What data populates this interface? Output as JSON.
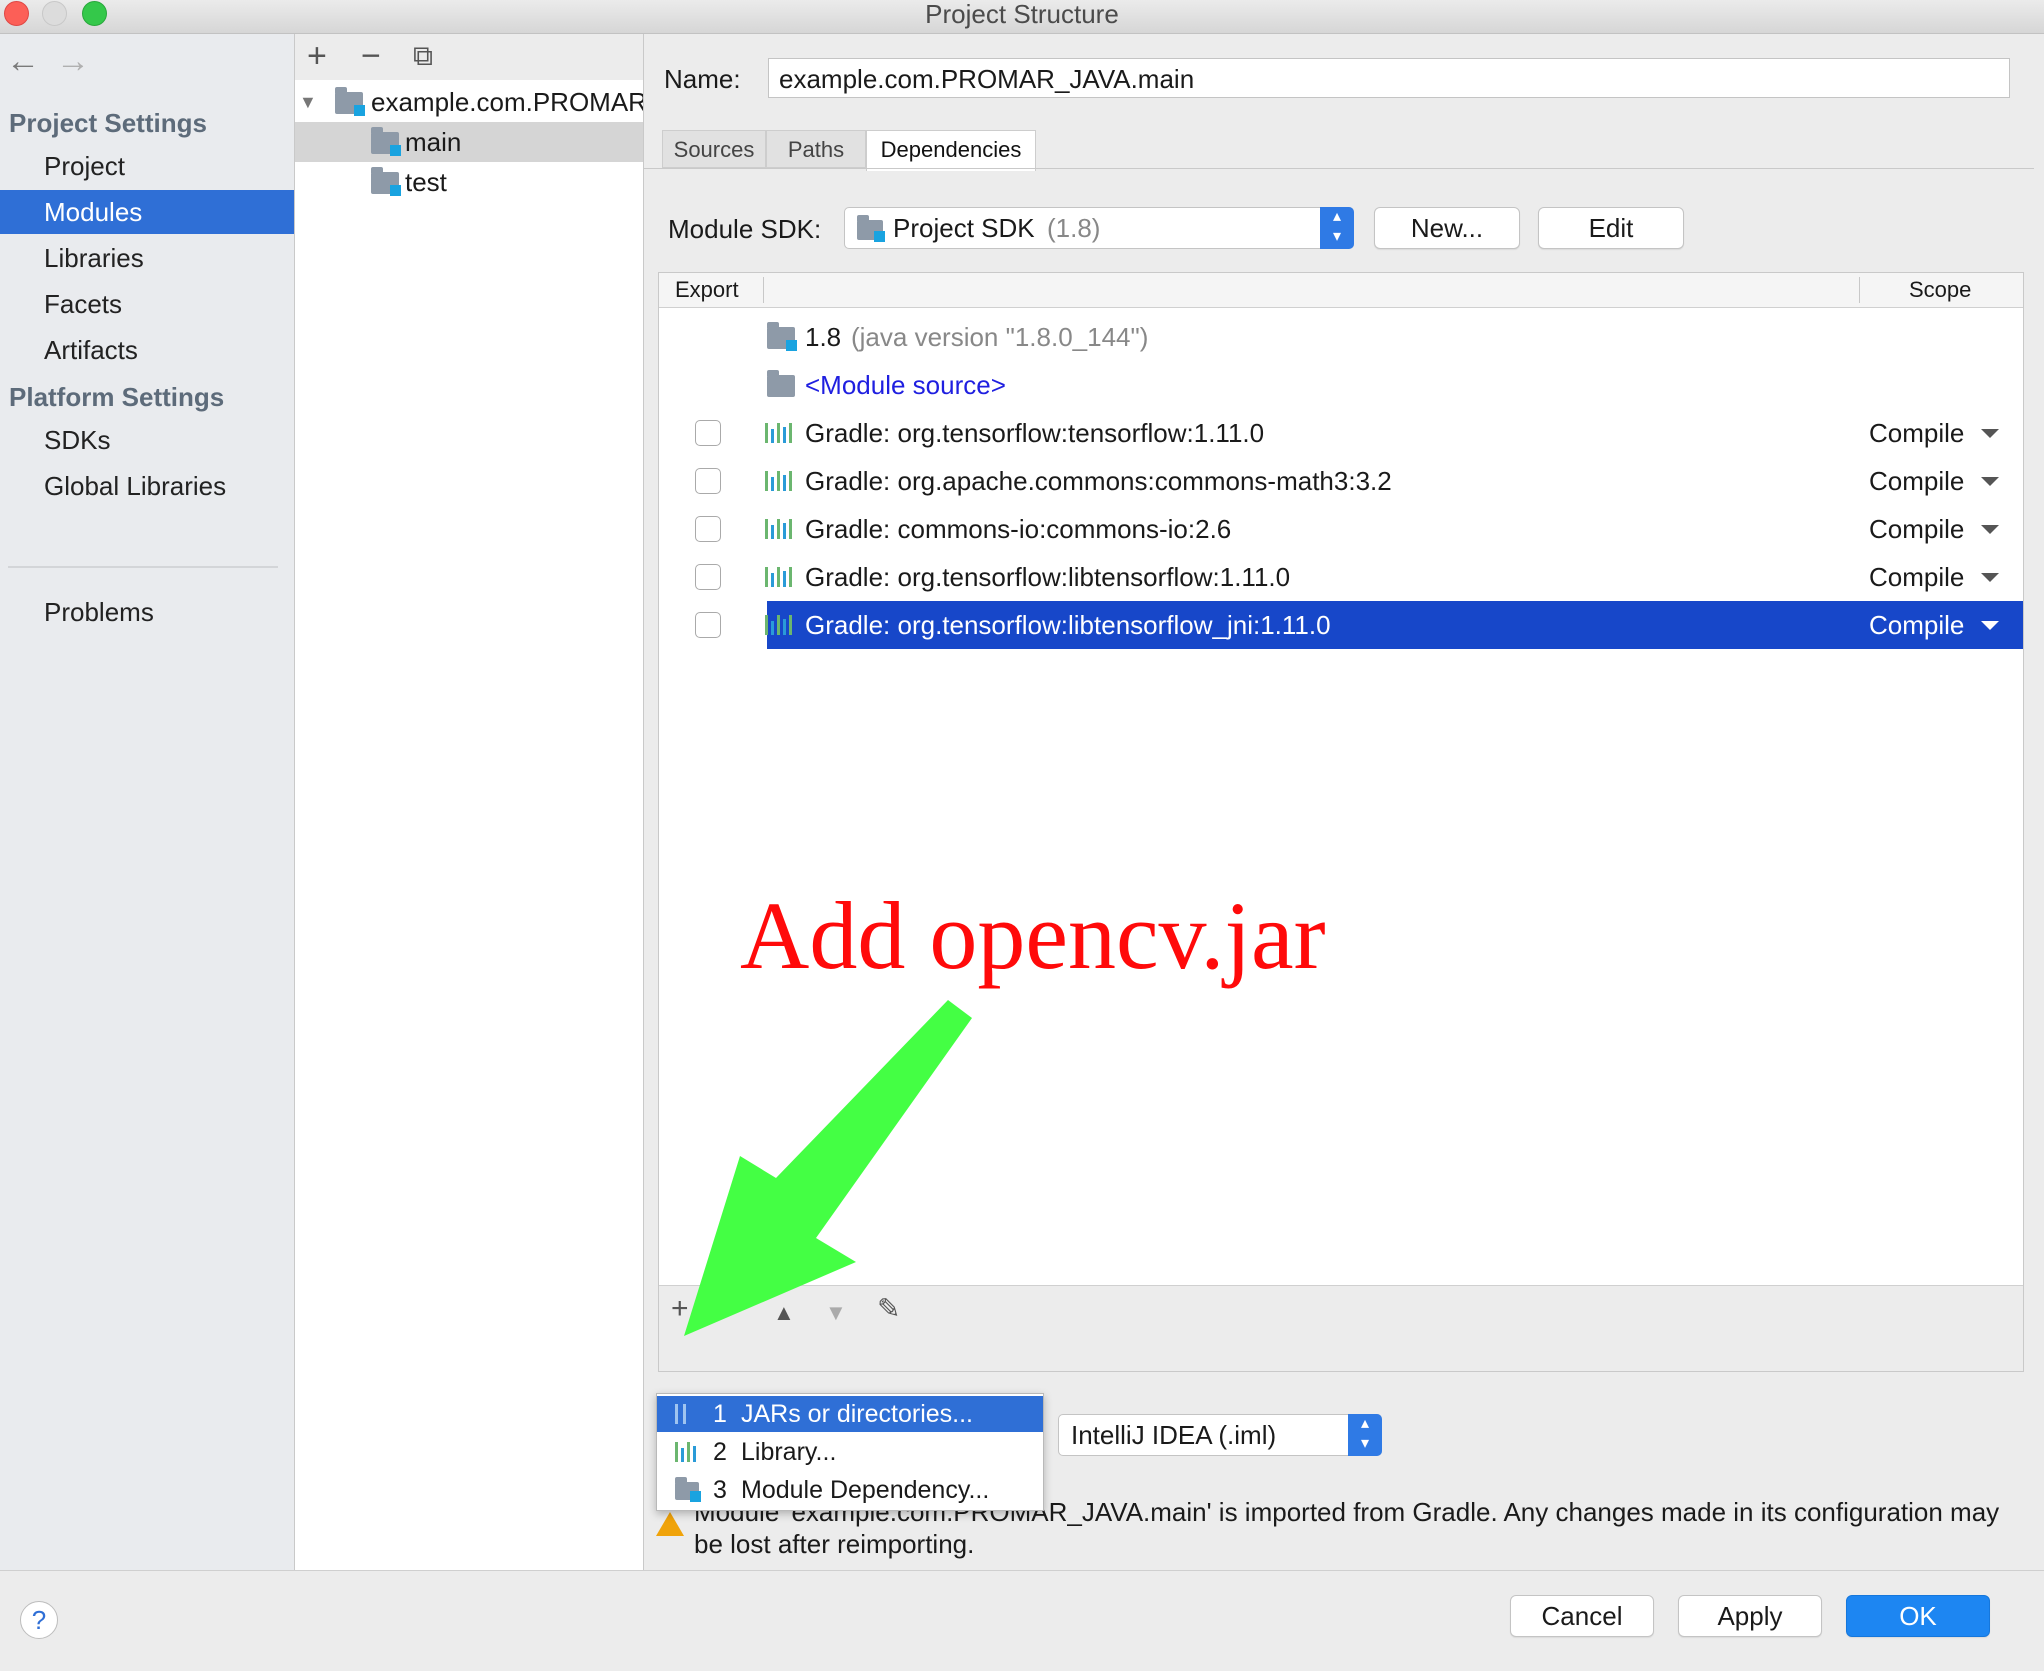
{
  "window": {
    "title": "Project Structure"
  },
  "nav": {
    "back": "←",
    "forward": "→",
    "project_settings_header": "Project Settings",
    "project_settings": [
      "Project",
      "Modules",
      "Libraries",
      "Facets",
      "Artifacts"
    ],
    "platform_settings_header": "Platform Settings",
    "platform_settings": [
      "SDKs",
      "Global Libraries"
    ],
    "problems": "Problems",
    "selected": "Modules"
  },
  "tree": {
    "toolbar": [
      "+",
      "−",
      "⧉"
    ],
    "root": "example.com.PROMAR",
    "children": [
      "main",
      "test"
    ],
    "selected": "main"
  },
  "module": {
    "name_label": "Name:",
    "name_value": "example.com.PROMAR_JAVA.main",
    "tabs": [
      "Sources",
      "Paths",
      "Dependencies"
    ],
    "active_tab": "Dependencies",
    "sdk_label": "Module SDK:",
    "sdk_value": "Project SDK",
    "sdk_version": "(1.8)",
    "new_button": "New...",
    "edit_button": "Edit"
  },
  "dependencies": {
    "col_export": "Export",
    "col_scope": "Scope",
    "jdk_name": "1.8",
    "jdk_detail": "(java version \"1.8.0_144\")",
    "module_source": "<Module source>",
    "rows": [
      {
        "name": "Gradle: org.tensorflow:tensorflow:1.11.0",
        "scope": "Compile"
      },
      {
        "name": "Gradle: org.apache.commons:commons-math3:3.2",
        "scope": "Compile"
      },
      {
        "name": "Gradle: commons-io:commons-io:2.6",
        "scope": "Compile"
      },
      {
        "name": "Gradle: org.tensorflow:libtensorflow:1.11.0",
        "scope": "Compile"
      },
      {
        "name": "Gradle: org.tensorflow:libtensorflow_jni:1.11.0",
        "scope": "Compile"
      }
    ],
    "selected_index": 4,
    "toolbar": [
      "+",
      "−",
      "▲",
      "▼",
      "✎"
    ]
  },
  "popup_menu": {
    "items": [
      {
        "num": "1",
        "label": "JARs or directories..."
      },
      {
        "num": "2",
        "label": "Library..."
      },
      {
        "num": "3",
        "label": "Module Dependency..."
      }
    ],
    "highlighted": 0
  },
  "format_combo": "IntelliJ IDEA (.iml)",
  "warning": "Module 'example.com.PROMAR_JAVA.main' is imported from Gradle. Any changes made in its configuration may be lost after reimporting.",
  "buttons": {
    "help": "?",
    "cancel": "Cancel",
    "apply": "Apply",
    "ok": "OK"
  },
  "annotation": {
    "text": "Add opencv.jar",
    "text_color": "#ff0a0a",
    "arrow_color": "#44ff44"
  },
  "colors": {
    "accent": "#2f6fd6",
    "selection": "#1747c9",
    "ok_button": "#1d86f2",
    "link": "#1f1fe0"
  }
}
